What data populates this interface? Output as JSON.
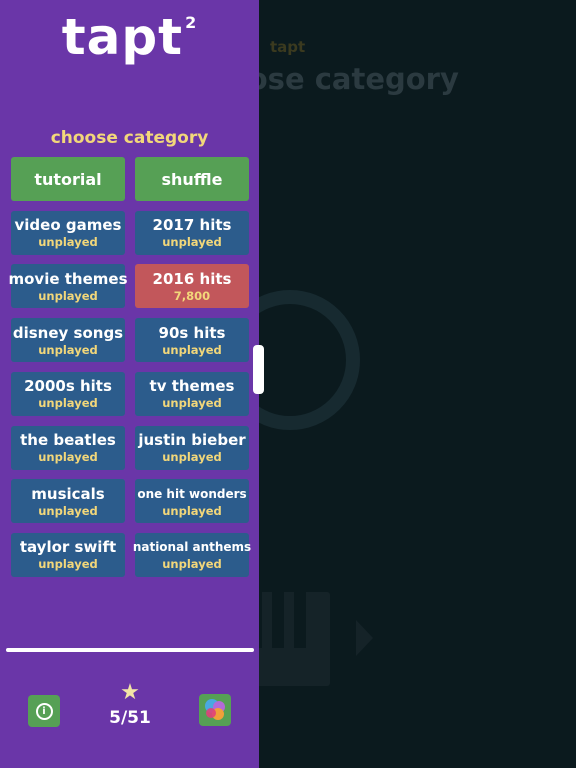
{
  "background": {
    "app_name": "tapt",
    "title": "choose category"
  },
  "panel": {
    "logo": "tapt",
    "logo_sup": "2",
    "heading": "choose category",
    "categories": [
      {
        "name": "tutorial",
        "sub": "",
        "style": "green"
      },
      {
        "name": "shuffle",
        "sub": "",
        "style": "green"
      },
      {
        "name": "video games",
        "sub": "unplayed",
        "style": "blue"
      },
      {
        "name": "2017 hits",
        "sub": "unplayed",
        "style": "blue"
      },
      {
        "name": "movie themes",
        "sub": "unplayed",
        "style": "blue"
      },
      {
        "name": "2016 hits",
        "sub": "7,800",
        "style": "red"
      },
      {
        "name": "disney songs",
        "sub": "unplayed",
        "style": "blue"
      },
      {
        "name": "90s hits",
        "sub": "unplayed",
        "style": "blue"
      },
      {
        "name": "2000s hits",
        "sub": "unplayed",
        "style": "blue"
      },
      {
        "name": "tv themes",
        "sub": "unplayed",
        "style": "blue"
      },
      {
        "name": "the beatles",
        "sub": "unplayed",
        "style": "blue"
      },
      {
        "name": "justin bieber",
        "sub": "unplayed",
        "style": "blue"
      },
      {
        "name": "musicals",
        "sub": "unplayed",
        "style": "blue"
      },
      {
        "name": "one hit wonders",
        "sub": "unplayed",
        "style": "blue"
      },
      {
        "name": "taylor swift",
        "sub": "unplayed",
        "style": "blue"
      },
      {
        "name": "national anthems",
        "sub": "unplayed",
        "style": "blue"
      }
    ],
    "footer": {
      "info_icon": "info-icon",
      "star_icon": "star-icon",
      "progress": "5/51",
      "friends_icon": "game-center-icon"
    }
  },
  "colors": {
    "panel": "#6a36a8",
    "tile_blue": "#2c5c8c",
    "tile_green": "#56a055",
    "tile_red": "#c2575b",
    "accent_yellow": "#f2d77a",
    "background": "#0b1a1e"
  }
}
